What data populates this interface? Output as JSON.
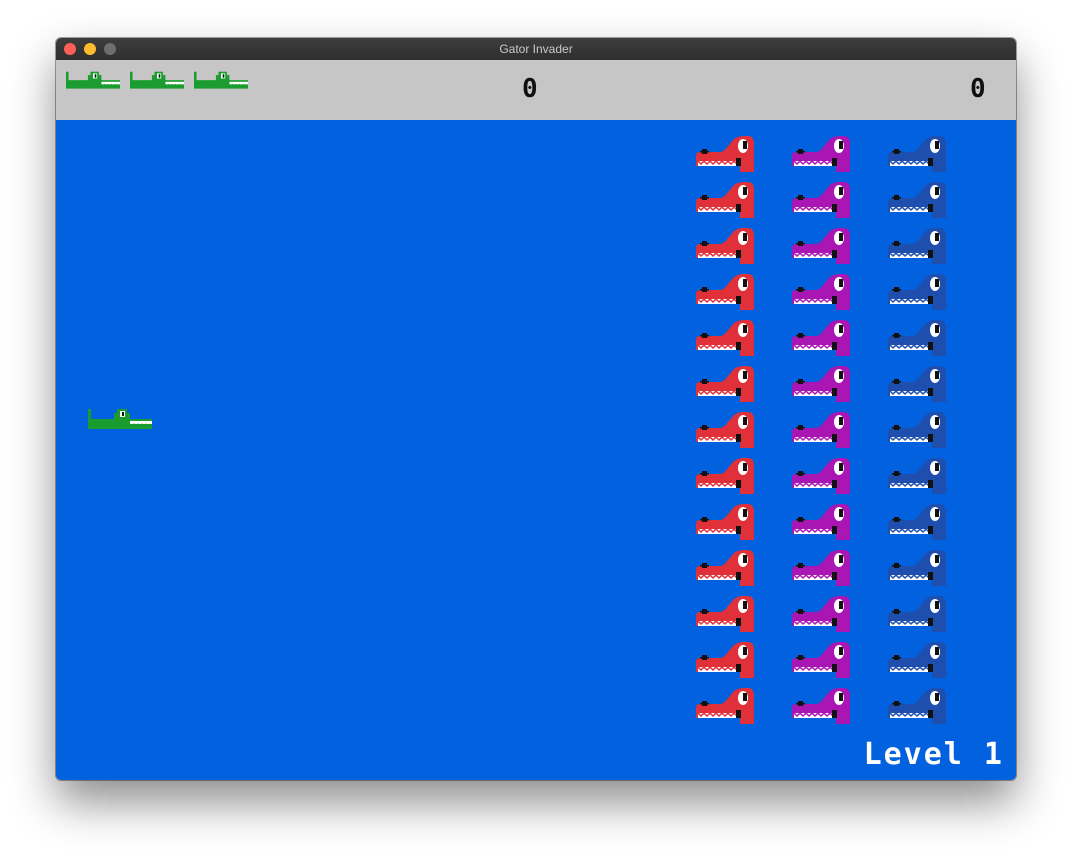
{
  "window": {
    "title": "Gator Invader"
  },
  "hud": {
    "lives": 3,
    "score_left": "0",
    "score_right": "0"
  },
  "game": {
    "level_text": "Level 1",
    "enemy_columns": [
      {
        "name": "red",
        "color": "#e0303a",
        "rows": 13
      },
      {
        "name": "purple",
        "color": "#a916b4",
        "rows": 13
      },
      {
        "name": "blue",
        "color": "#1f4fae",
        "rows": 13
      }
    ],
    "player_color": "#1a9c2f",
    "background_color": "#0161de"
  }
}
